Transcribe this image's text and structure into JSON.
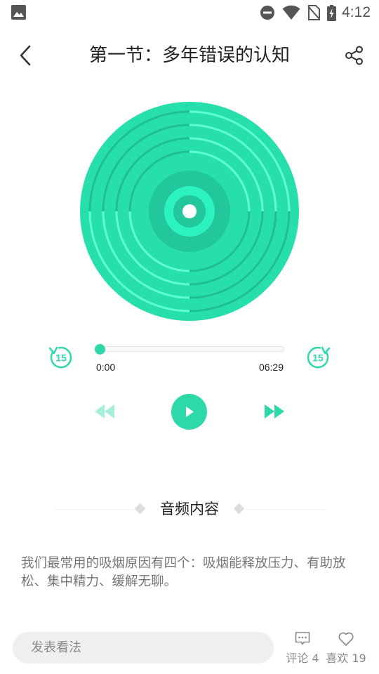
{
  "status_bar": {
    "time": "4:12",
    "icons": [
      "gallery-icon",
      "do-not-disturb-icon",
      "wifi-icon",
      "no-sim-icon",
      "battery-charging-icon"
    ]
  },
  "header": {
    "title": "第一节：多年错误的认知",
    "back_icon": "back-arrow-icon",
    "share_icon": "share-icon"
  },
  "player": {
    "accent_color": "#2dd9a8",
    "current_time": "0:00",
    "total_time": "06:29",
    "progress": 0.0,
    "skip_back_label": "15",
    "skip_forward_label": "15"
  },
  "section": {
    "title": "音频内容",
    "content": "我们最常用的吸烟原因有四个：吸烟能释放压力、有助放松、集中精力、缓解无聊。"
  },
  "bottom_bar": {
    "comment_placeholder": "发表看法",
    "comments_label": "评论 4",
    "likes_label": "喜欢 19"
  }
}
